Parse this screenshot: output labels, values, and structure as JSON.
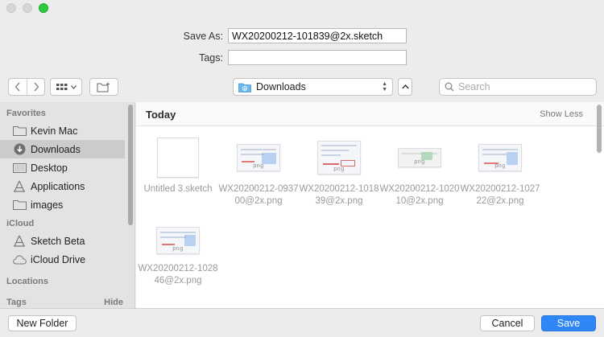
{
  "form": {
    "save_as_label": "Save As:",
    "save_as_value": "WX20200212-101839@2x.sketch",
    "tags_label": "Tags:",
    "tags_value": ""
  },
  "toolbar": {
    "back_icon": "chevron-left-icon",
    "forward_icon": "chevron-right-icon",
    "view_icon": "grid-view-icon",
    "new_folder_icon": "new-folder-icon",
    "location": "Downloads",
    "search_placeholder": "Search"
  },
  "sidebar": {
    "favorites_heading": "Favorites",
    "favorites": [
      {
        "label": "Kevin Mac",
        "icon": "folder-icon"
      },
      {
        "label": "Downloads",
        "icon": "downloads-icon",
        "selected": true
      },
      {
        "label": "Desktop",
        "icon": "desktop-icon"
      },
      {
        "label": "Applications",
        "icon": "applications-icon"
      },
      {
        "label": "images",
        "icon": "folder-icon"
      }
    ],
    "icloud_heading": "iCloud",
    "icloud": [
      {
        "label": "Sketch Beta",
        "icon": "applications-icon"
      },
      {
        "label": "iCloud Drive",
        "icon": "cloud-icon"
      }
    ],
    "locations_heading": "Locations",
    "tags_heading": "Tags",
    "tags_hide": "Hide"
  },
  "main": {
    "section_title": "Today",
    "show_less": "Show Less",
    "files": [
      {
        "name": "Untitled 3.sketch"
      },
      {
        "name": "WX20200212-093700@2x.png",
        "tag": "png"
      },
      {
        "name": "WX20200212-101839@2x.png",
        "tag": "png"
      },
      {
        "name": "WX20200212-102010@2x.png",
        "tag": "png"
      },
      {
        "name": "WX20200212-102722@2x.png",
        "tag": "png"
      },
      {
        "name": "WX20200212-102846@2x.png",
        "tag": "png"
      }
    ]
  },
  "buttons": {
    "new_folder": "New Folder",
    "cancel": "Cancel",
    "save": "Save"
  },
  "colors": {
    "accent": "#2f86f6",
    "close_light": "#d6d6d6",
    "zoom_light": "#2dc941",
    "folder_blue": "#5aa9e6"
  }
}
